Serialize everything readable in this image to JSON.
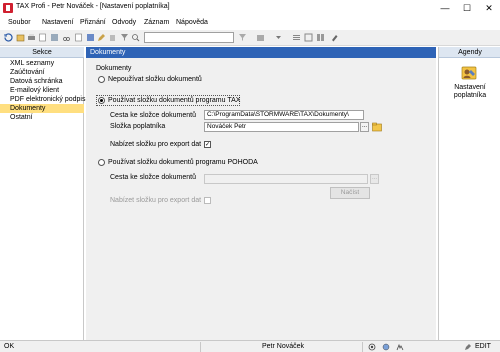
{
  "window": {
    "title": "TAX Profi - Petr Nováček - [Nastavení poplatníka]",
    "controls": {
      "minimize": "—",
      "maximize": "☐",
      "close": "✕"
    }
  },
  "menu": [
    "Soubor",
    "Nastavení",
    "Přiznání",
    "Odvody",
    "Záznam",
    "Nápověda"
  ],
  "left_panel": {
    "header": "Sekce",
    "items": [
      {
        "label": "XML seznamy",
        "selected": false
      },
      {
        "label": "Zaúčtování",
        "selected": false
      },
      {
        "label": "Datová schránka",
        "selected": false
      },
      {
        "label": "E-mailový klient",
        "selected": false
      },
      {
        "label": "PDF elektronický podpis",
        "selected": false
      },
      {
        "label": "Dokumenty",
        "selected": true
      },
      {
        "label": "Ostatní",
        "selected": false
      }
    ]
  },
  "main": {
    "header": "Dokumenty",
    "group_label": "Dokumenty",
    "option_none": {
      "label": "Nepoužívat složku dokumentů",
      "checked": false
    },
    "option_tax": {
      "label": "Používat složku dokumentů programu TAX",
      "checked": true,
      "path_label": "Cesta ke složce dokumentů",
      "path_value": "C:\\ProgramData\\STORMWARE\\TAX\\Dokumenty\\",
      "folder_label": "Složka poplatníka",
      "folder_value": "Nováček Petr",
      "browse_button": "...",
      "export_label": "Nabízet složku pro export dat",
      "export_checked": true
    },
    "option_pohoda": {
      "label": "Používat složku dokumentů programu POHODA",
      "checked": false,
      "path_label": "Cesta ke složce dokumentů",
      "path_value": "",
      "browse_button": "...",
      "load_button": "Načíst",
      "export_label": "Nabízet složku pro export dat",
      "export_checked": false
    },
    "check_mark": "✓"
  },
  "right_panel": {
    "header": "Agendy",
    "item_label": "Nastavení poplatníka"
  },
  "status": {
    "left": "OK",
    "user": "Petr Nováček",
    "mode": "EDIT"
  },
  "colors": {
    "header_blue": "#2e63b6",
    "selection_yellow": "#ffdf80",
    "panel_header": "#dde6f1"
  }
}
